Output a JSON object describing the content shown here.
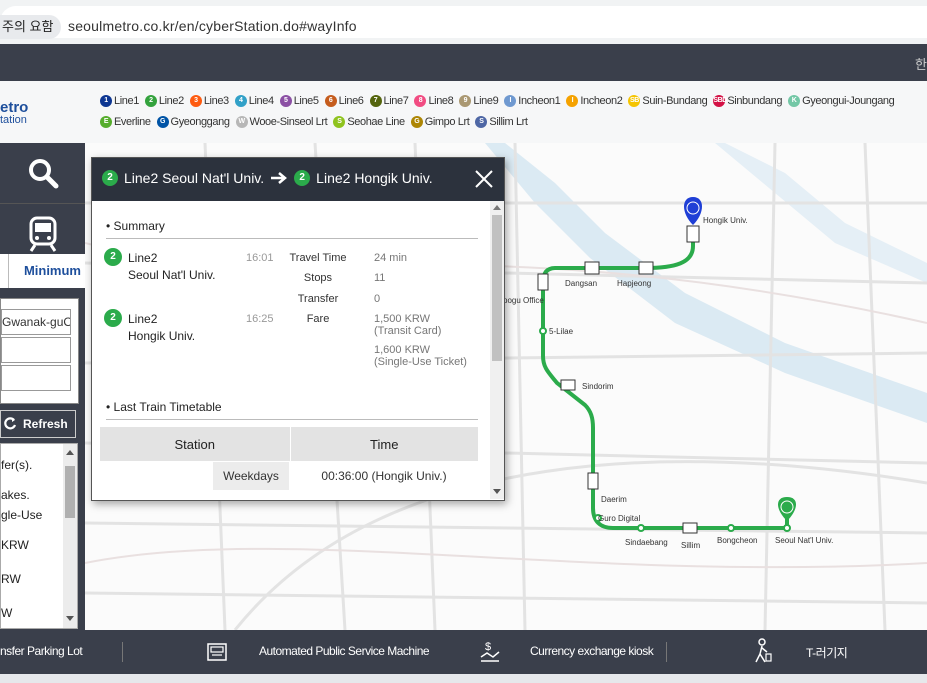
{
  "browser": {
    "warning_badge": "주의 요함",
    "url": "seoulmetro.co.kr/en/cyberStation.do#wayInfo"
  },
  "logo": {
    "line1": "etro",
    "line2": "tation"
  },
  "darkbar_glyph": "한",
  "lines_row1": [
    {
      "label": "Line1",
      "badge": "1",
      "color": "#0d3692"
    },
    {
      "label": "Line2",
      "badge": "2",
      "color": "#33a23d"
    },
    {
      "label": "Line3",
      "badge": "3",
      "color": "#fe5b10"
    },
    {
      "label": "Line4",
      "badge": "4",
      "color": "#32a1c8"
    },
    {
      "label": "Line5",
      "badge": "5",
      "color": "#8b50a4"
    },
    {
      "label": "Line6",
      "badge": "6",
      "color": "#c55c1d"
    },
    {
      "label": "Line7",
      "badge": "7",
      "color": "#54640d"
    },
    {
      "label": "Line8",
      "badge": "8",
      "color": "#f14c82"
    },
    {
      "label": "Line9",
      "badge": "9",
      "color": "#aa9872"
    },
    {
      "label": "Incheon1",
      "badge": "I",
      "color": "#6f99d0"
    },
    {
      "label": "Incheon2",
      "badge": "I",
      "color": "#f5a200"
    },
    {
      "label": "Suin-Bundang",
      "badge": "SB",
      "color": "#f5c400"
    },
    {
      "label": "Sinbundang",
      "badge": "SBD",
      "color": "#d31145"
    },
    {
      "label": "Gyeongui-Joungang",
      "badge": "K",
      "color": "#73c7a6"
    }
  ],
  "lines_row2": [
    {
      "label": "Everline",
      "badge": "E",
      "color": "#56ad2d"
    },
    {
      "label": "Gyeonggang",
      "badge": "G",
      "color": "#0054a6"
    },
    {
      "label": "Wooe-Sinseol Lrt",
      "badge": "W",
      "color": "#b7b7b7"
    },
    {
      "label": "Seohae Line",
      "badge": "S",
      "color": "#8fc31f"
    },
    {
      "label": "Gimpo Lrt",
      "badge": "G",
      "color": "#ad8605"
    },
    {
      "label": "Sillim Lrt",
      "badge": "S",
      "color": "#4e67a5"
    }
  ],
  "sidebar": {
    "minimum_label": "Minimum",
    "from_value": "Gwanak-guOf",
    "refresh_label": "Refresh",
    "list_items": [
      "fer(s).",
      "akes.",
      "gle-Use",
      "KRW",
      "RW",
      "W"
    ]
  },
  "popup": {
    "from_badge": "2",
    "from_title": "Line2 Seoul Nat'l Univ.",
    "to_badge": "2",
    "to_title": "Line2 Hongik Univ.",
    "summary_label": "Summary",
    "origin": {
      "badge": "2",
      "line": "Line2",
      "station": "Seoul Nat'l Univ.",
      "time": "16:01"
    },
    "destination": {
      "badge": "2",
      "line": "Line2",
      "station": "Hongik Univ.",
      "time": "16:25"
    },
    "travel_time_label": "Travel Time",
    "travel_time": "24 min",
    "stops_label": "Stops",
    "stops": "11",
    "transfer_label": "Transfer",
    "transfer": "0",
    "fare_label": "Fare",
    "fare1": "1,500 KRW",
    "fare1_note": "(Transit Card)",
    "fare2": "1,600 KRW",
    "fare2_note": "(Single-Use Ticket)",
    "last_train_label": "Last Train Timetable",
    "col_station": "Station",
    "col_time": "Time",
    "row_day": "Weekdays",
    "row_time": "00:36:00 (Hongik Univ.)"
  },
  "map": {
    "labels": {
      "hongik": "Hongik Univ.",
      "dangsan": "Dangsan",
      "hapjeong": "Hapjeong",
      "yeongdeungpo": "pogu Office",
      "mullae": "5-Lilae",
      "sindorim": "Sindorim",
      "daerim": "Daerim",
      "guro": "Guro Digital",
      "sindaebang": "Sindaebang",
      "sillim": "Sillim",
      "bongcheon": "Bongcheon",
      "snu": "Seoul Nat'l Univ."
    },
    "route_color": "#2bab4b",
    "river_color": "#dbeaf3"
  },
  "bottombar": {
    "parking": "nsfer Parking Lot",
    "machine": "Automated Public Service Machine",
    "exchange": "Currency exchange kiosk",
    "other": "T-러기지"
  }
}
